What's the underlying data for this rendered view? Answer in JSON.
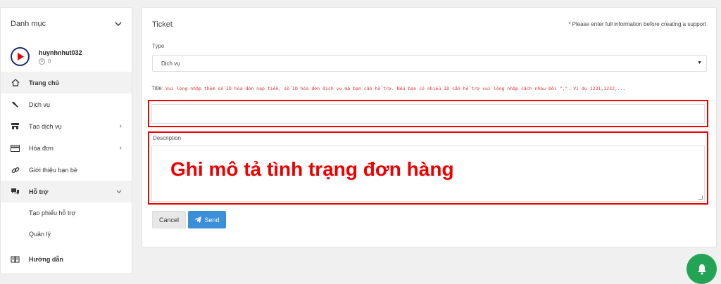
{
  "sidebar": {
    "header": "Danh mục",
    "username": "huynhnhut032",
    "balance": "0",
    "items": [
      {
        "label": "Trang chủ",
        "icon": "home-icon"
      },
      {
        "label": "Dịch vụ",
        "icon": "wrench-icon"
      },
      {
        "label": "Tạo dịch vụ",
        "icon": "store-icon"
      },
      {
        "label": "Hóa đơn",
        "icon": "credit-card-icon"
      },
      {
        "label": "Giới thiệu bạn bè",
        "icon": "link-icon"
      },
      {
        "label": "Hỗ trợ",
        "icon": "chat-icon"
      },
      {
        "label": "Tạo phiếu hỗ trợ"
      },
      {
        "label": "Quản lý"
      },
      {
        "label": "Hướng dẫn",
        "icon": "book-icon"
      }
    ]
  },
  "main": {
    "title": "Ticket",
    "note": "* Please enter full information before creating a support",
    "type_label": "Type",
    "type_value": "Dịch vụ",
    "title_label": "Title:",
    "title_hint": "Vui lòng nhập thêm số ID hóa đơn nạp tiền, số ID hóa đơn dịch vụ mà bạn cần hỗ trợ. Nếu bạn có nhiều ID cần hỗ trợ vui lòng nhập cách nhau bởi \",\". Ví dụ 1231,1232,...",
    "description_label": "Description",
    "annotation": "Ghi mô tả tình trạng đơn hàng",
    "cancel_label": "Cancel",
    "send_label": "Send"
  },
  "colors": {
    "accent": "#3b8fd9",
    "highlight": "#ee0000",
    "bell": "#23a455",
    "hint": "#dd3333"
  }
}
